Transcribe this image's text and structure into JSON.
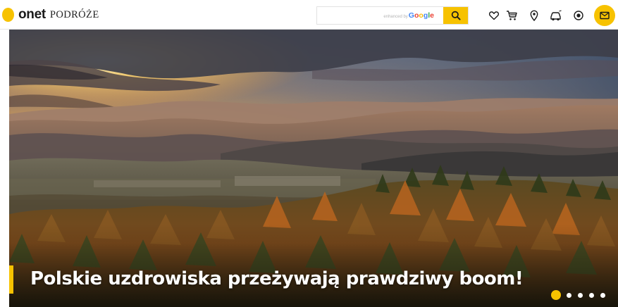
{
  "brand": {
    "name": "onet",
    "section": "PODRÓŻE",
    "accent_color": "#f7c200"
  },
  "search": {
    "value": "",
    "powered_by": "enhanced by",
    "provider": "Google",
    "button_icon": "search-icon"
  },
  "nav_icons": [
    "heart-icon",
    "cart-icon",
    "map-pin-icon",
    "car-icon",
    "radio-icon",
    "mail-icon"
  ],
  "hero": {
    "headline": "Polskie uzdrowiska przeżywają prawdziwy boom!",
    "slides_total": 5,
    "active_slide": 1
  }
}
